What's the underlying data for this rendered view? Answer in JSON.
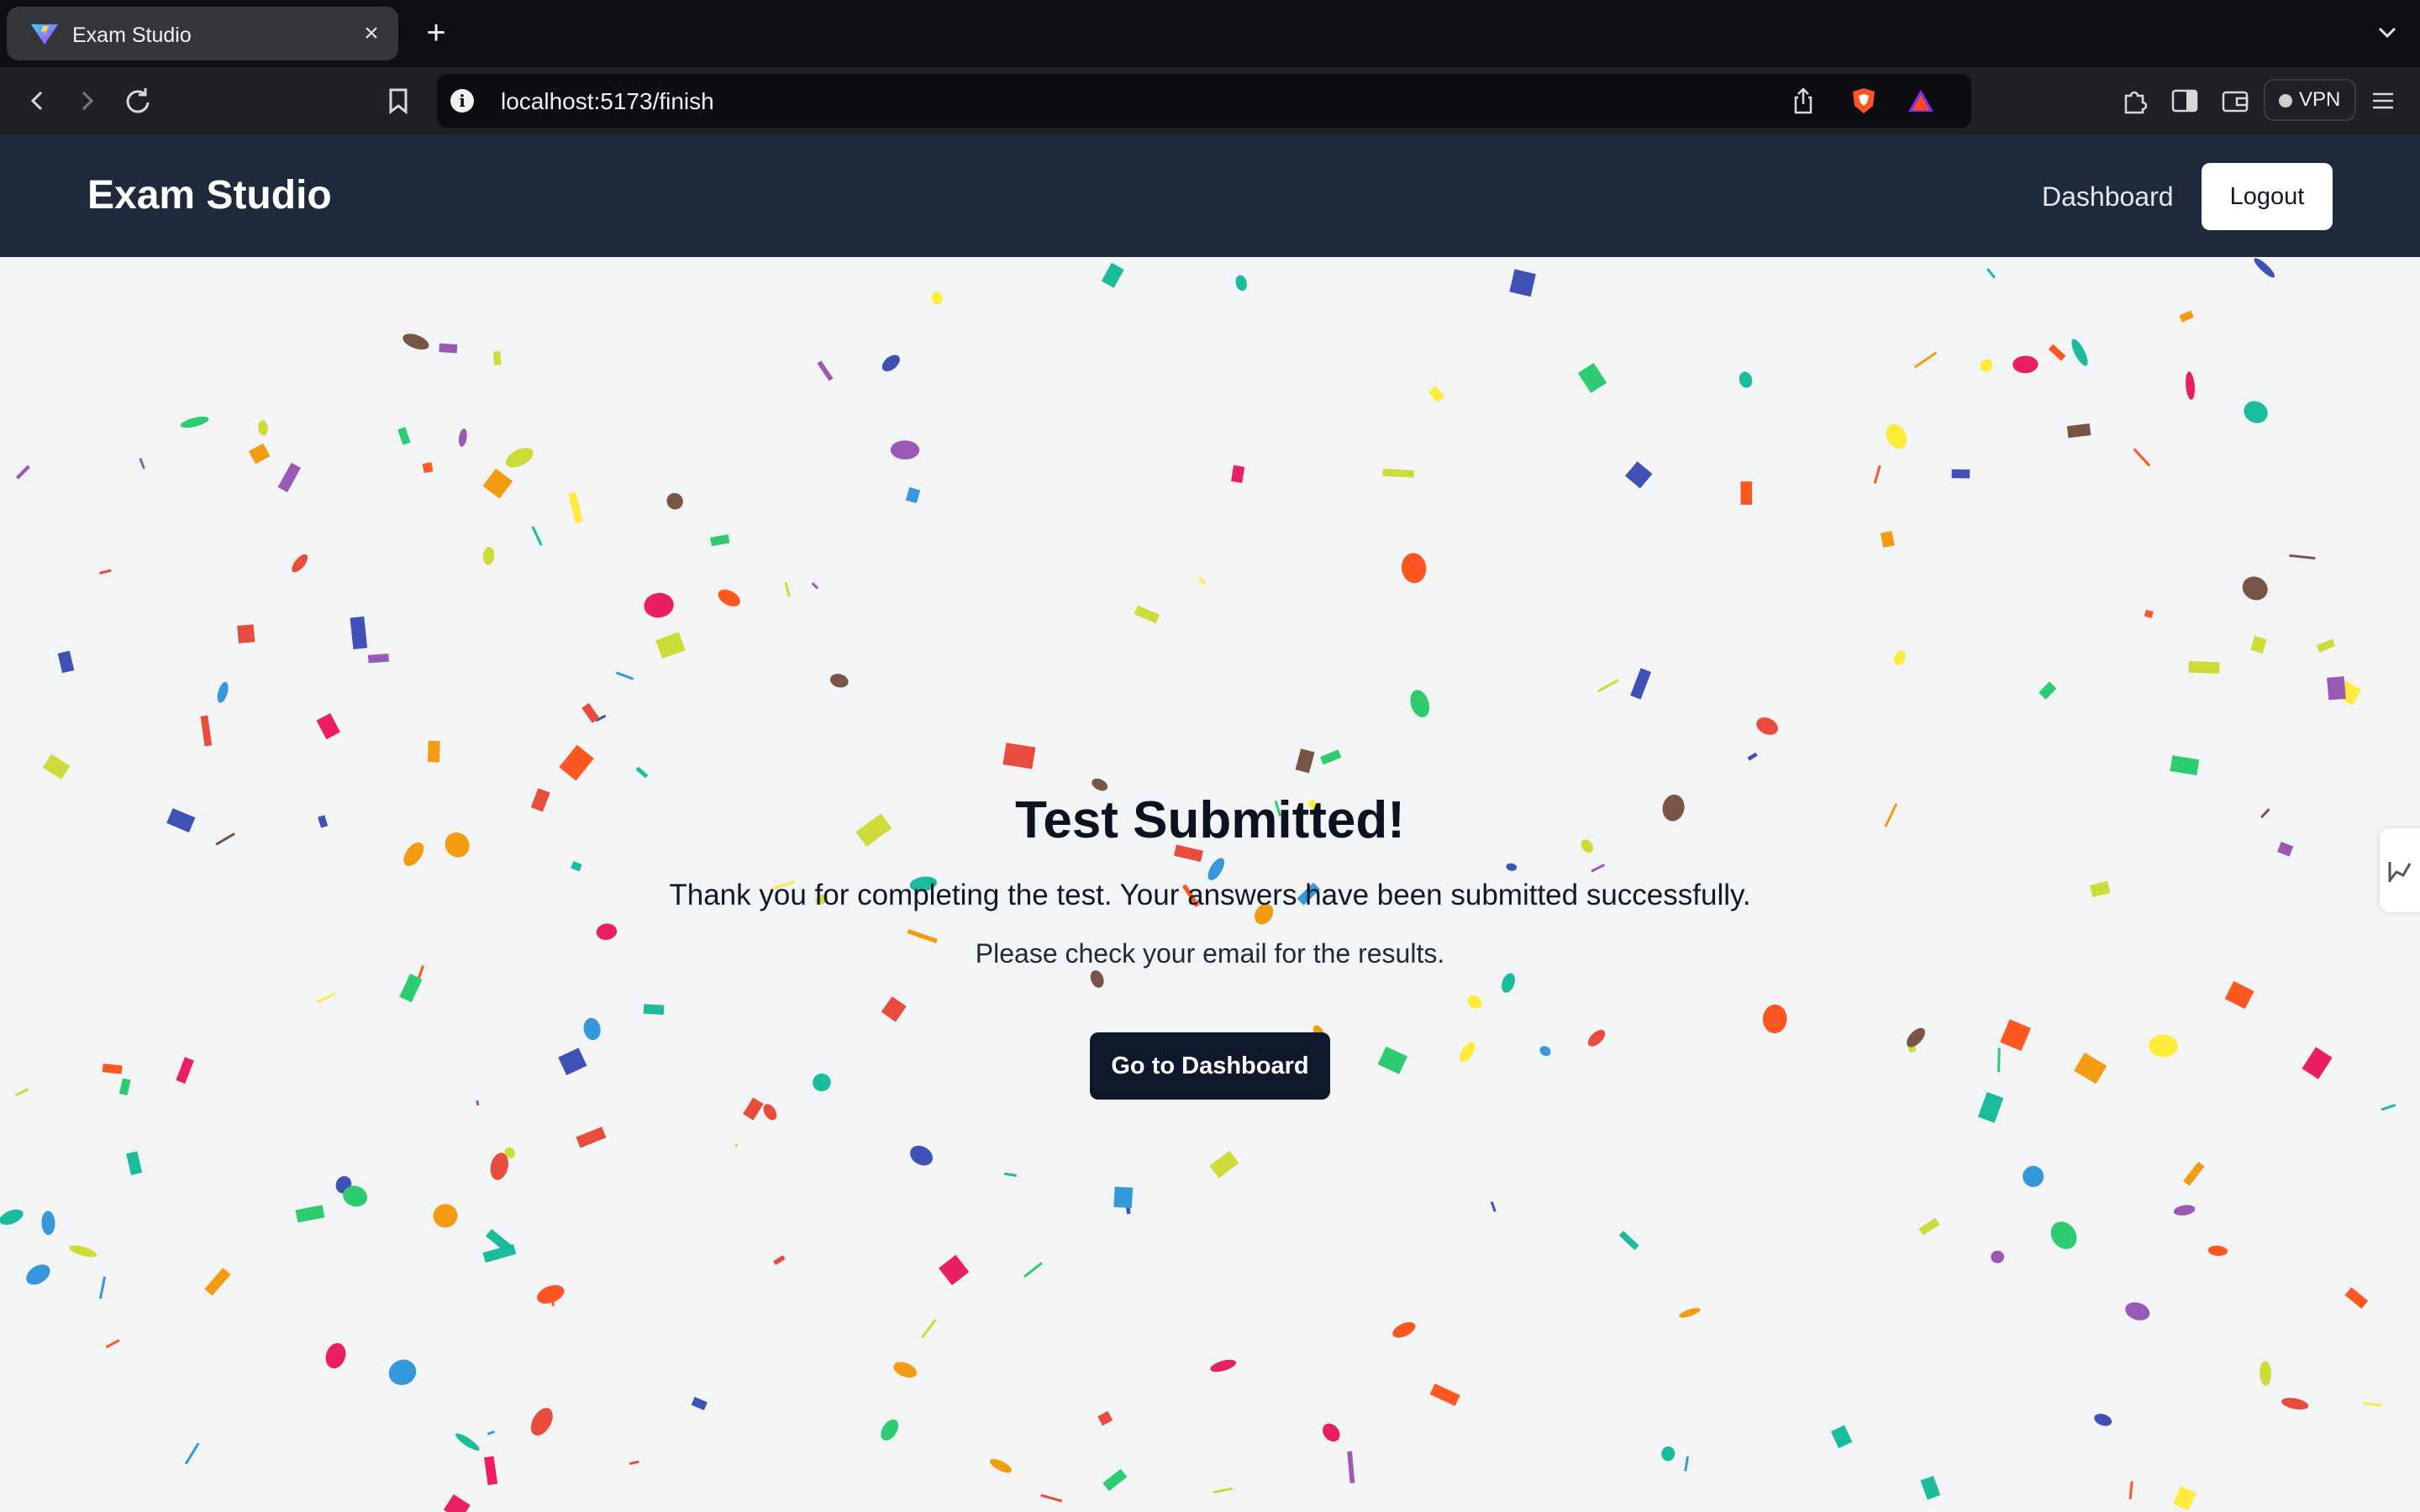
{
  "browser": {
    "tab_title": "Exam Studio",
    "tab_close_icon": "close-icon",
    "new_tab_icon": "plus-icon",
    "url": "localhost:5173/finish",
    "vpn_label": "VPN"
  },
  "header": {
    "logo": "Exam Studio",
    "nav_dashboard": "Dashboard",
    "logout_label": "Logout"
  },
  "main": {
    "title": "Test Submitted!",
    "message": "Thank you for completing the test. Your answers have been submitted successfully.",
    "note": "Please check your email for the results.",
    "cta_label": "Go to Dashboard"
  },
  "colors": {
    "header_bg": "#1e293b",
    "page_bg": "#f3f4f6",
    "cta_bg": "#0f172a",
    "confetti": [
      "#e74c3c",
      "#3498db",
      "#2ecc71",
      "#f39c12",
      "#9b59b6",
      "#1abc9c",
      "#e91e63",
      "#3f51b5",
      "#cddc39",
      "#ffeb3b",
      "#795548",
      "#ff5722"
    ]
  }
}
